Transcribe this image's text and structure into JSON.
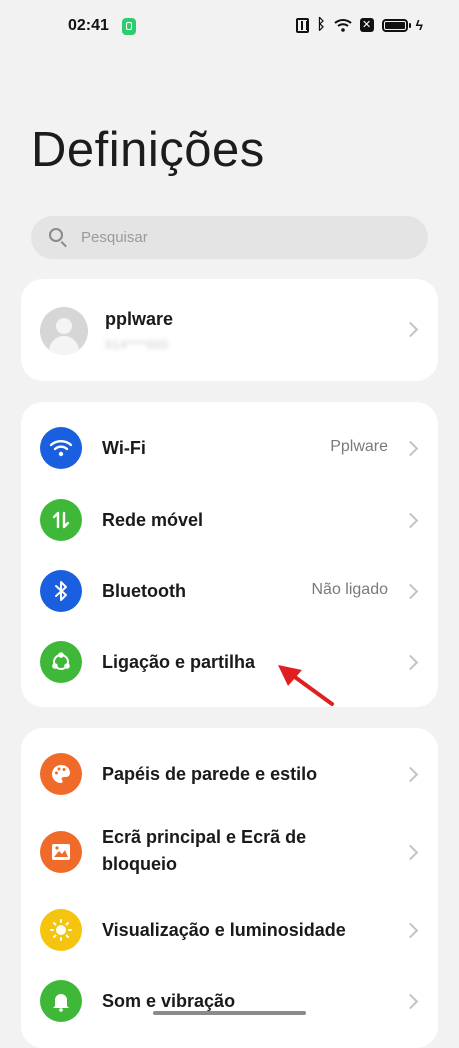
{
  "status_bar": {
    "time": "02:41"
  },
  "header": {
    "title": "Definições"
  },
  "search": {
    "placeholder": "Pesquisar"
  },
  "profile": {
    "name": "pplware",
    "number": "914****665"
  },
  "group1": [
    {
      "label": "Wi-Fi",
      "value": "Pplware",
      "icon": "wifi-icon",
      "color": "#1a5fe0"
    },
    {
      "label": "Rede móvel",
      "value": "",
      "icon": "mobile-data-icon",
      "color": "#3fb83a"
    },
    {
      "label": "Bluetooth",
      "value": "Não ligado",
      "icon": "bluetooth-icon",
      "color": "#1a5fe0"
    },
    {
      "label": "Ligação e partilha",
      "value": "",
      "icon": "share-icon",
      "color": "#3fb83a"
    }
  ],
  "group2": [
    {
      "label": "Papéis de parede e estilo",
      "icon": "palette-icon",
      "color": "#f06b2a"
    },
    {
      "label": "Ecrã principal e Ecrã de",
      "label2": "bloqueio",
      "icon": "image-icon",
      "color": "#f06b2a"
    },
    {
      "label": "Visualização e luminosidade",
      "icon": "brightness-icon",
      "color": "#f5c40f"
    },
    {
      "label": "Som e vibração",
      "icon": "bell-icon",
      "color": "#3fb83a"
    }
  ],
  "colors": {
    "background": "#f2f2f2",
    "card": "#ffffff",
    "annotation_arrow": "#e02020"
  }
}
